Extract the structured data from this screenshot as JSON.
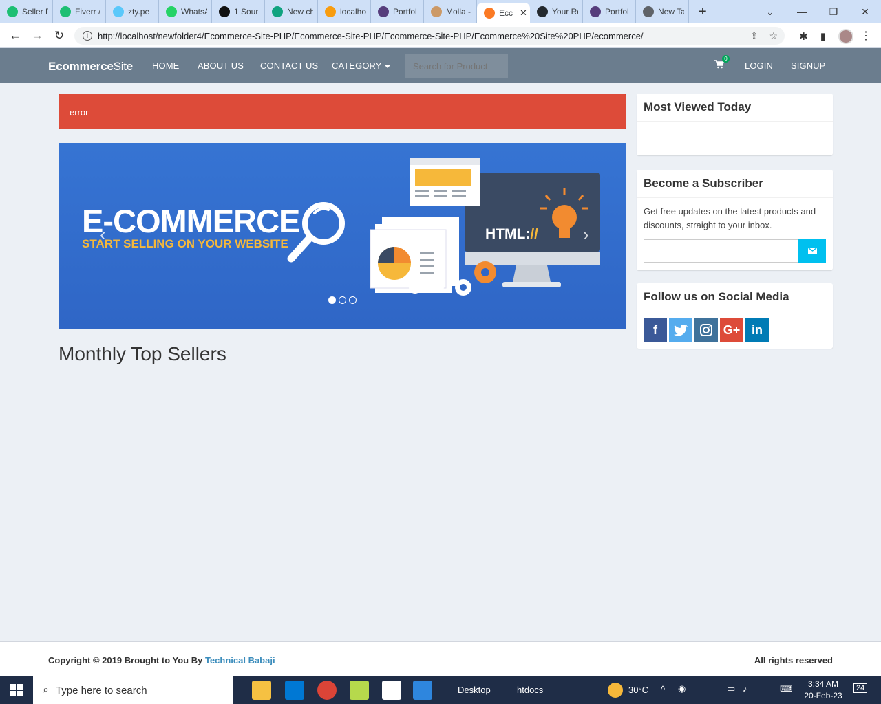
{
  "browser": {
    "tabs": [
      {
        "label": "Seller D",
        "icon": "fiverr-icon",
        "color": "#1dbf73"
      },
      {
        "label": "Fiverr /",
        "icon": "fiverr-icon",
        "color": "#1dbf73"
      },
      {
        "label": "zty.pe",
        "icon": "zty-icon",
        "color": "#5ac8fa"
      },
      {
        "label": "WhatsA",
        "icon": "whatsapp-icon",
        "color": "#25d366"
      },
      {
        "label": "1 Sour",
        "icon": "source-icon",
        "color": "#111111"
      },
      {
        "label": "New ch",
        "icon": "chatgpt-icon",
        "color": "#10a37f"
      },
      {
        "label": "localho",
        "icon": "phpmyadmin-icon",
        "color": "#f89c0e"
      },
      {
        "label": "Portfol",
        "icon": "bootstrap-icon",
        "color": "#563d7c"
      },
      {
        "label": "Molla -",
        "icon": "molla-icon",
        "color": "#c96"
      },
      {
        "label": "Ecc",
        "icon": "xampp-icon",
        "color": "#fb7a24"
      },
      {
        "label": "Your Re",
        "icon": "github-icon",
        "color": "#24292e"
      },
      {
        "label": "Portfol",
        "icon": "bootstrap-icon",
        "color": "#563d7c"
      },
      {
        "label": "New Ta",
        "icon": "chrome-icon",
        "color": "#5f6368"
      }
    ],
    "url": "http://localhost/newfolder4/Ecommerce-Site-PHP/Ecommerce-Site-PHP/Ecommerce-Site-PHP/Ecommerce%20Site%20PHP/ecommerce/"
  },
  "navbar": {
    "brand_bold": "Ecommerce",
    "brand_rest": "Site",
    "links": {
      "home": "HOME",
      "about": "ABOUT US",
      "contact": "CONTACT US",
      "category": "CATEGORY"
    },
    "search_placeholder": "Search for Product",
    "cart_count": "0",
    "login": "LOGIN",
    "signup": "SIGNUP",
    "bg_color": "#6b7d8e"
  },
  "alert": {
    "text": "error",
    "color": "#dd4b39"
  },
  "carousel": {
    "title": "E-COMMERCE",
    "subtitle": "START SELLING ON YOUR WEBSITE",
    "monitor_text": "HTML:",
    "monitor_accent": "//",
    "active_slide": 1,
    "slide_count": 3
  },
  "main": {
    "heading": "Monthly Top Sellers"
  },
  "sidebar": {
    "most_viewed_title": "Most Viewed Today",
    "subscriber_title": "Become a Subscriber",
    "subscriber_text": "Get free updates on the latest products and discounts, straight to your inbox.",
    "social_title": "Follow us on Social Media",
    "social": [
      {
        "name": "facebook",
        "glyph": "f",
        "color": "#3b5998"
      },
      {
        "name": "twitter",
        "glyph": "t",
        "color": "#55acee"
      },
      {
        "name": "instagram",
        "glyph": "ig",
        "color": "#3f729b"
      },
      {
        "name": "google-plus",
        "glyph": "G+",
        "color": "#dd4b39"
      },
      {
        "name": "linkedin",
        "glyph": "in",
        "color": "#007bb5"
      }
    ]
  },
  "footer": {
    "copyright": "Copyright © 2019 Brought to You By ",
    "author": "Technical Babaji",
    "rights": "All rights reserved"
  },
  "taskbar": {
    "search_placeholder": "Type here to search",
    "desktop": "Desktop",
    "htdocs": "htdocs",
    "temperature": "30°C",
    "time": "3:34 AM",
    "date": "20-Feb-23",
    "notifications": "24"
  }
}
